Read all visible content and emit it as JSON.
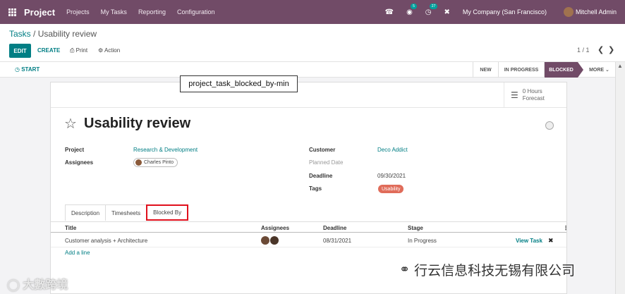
{
  "navbar": {
    "app_name": "Project",
    "menu": [
      "Projects",
      "My Tasks",
      "Reporting",
      "Configuration"
    ],
    "messages_count": "5",
    "activities_count": "27",
    "company": "My Company (San Francisco)",
    "user": "Mitchell Admin",
    "accent_color": "#714b67"
  },
  "control": {
    "breadcrumb_parent": "Tasks",
    "breadcrumb_sep": " / ",
    "breadcrumb_current": "Usability review",
    "edit_label": "EDIT",
    "create_label": "CREATE",
    "print_label": "Print",
    "action_label": "Action",
    "pager": "1 / 1",
    "primary_color": "#017e84"
  },
  "statusbar": {
    "start_label": "START",
    "stages": [
      "NEW",
      "IN PROGRESS",
      "BLOCKED"
    ],
    "active_stage": "BLOCKED",
    "more_label": "MORE"
  },
  "tooltip": "project_task_blocked_by-min",
  "smart_button": {
    "value": "0 Hours",
    "label": "Forecast"
  },
  "task": {
    "title": "Usability review",
    "project_label": "Project",
    "project_value": "Research & Development",
    "assignees_label": "Assignees",
    "assignee": "Charles Pinto",
    "customer_label": "Customer",
    "customer_value": "Deco Addict",
    "planned_date_label": "Planned Date",
    "deadline_label": "Deadline",
    "deadline_value": "09/30/2021",
    "tags_label": "Tags",
    "tag": "Usability"
  },
  "tabs": [
    "Description",
    "Timesheets",
    "Blocked By"
  ],
  "active_tab": "Blocked By",
  "table": {
    "headers": [
      "Title",
      "Assignees",
      "Deadline",
      "Stage"
    ],
    "rows": [
      {
        "title": "Customer analysis + Architecture",
        "deadline": "08/31/2021",
        "stage": "In Progress",
        "action": "View Task"
      }
    ],
    "add_line": "Add a line"
  },
  "watermark": {
    "left": "大數跨境",
    "right": "行云信息科技无锡有限公司"
  }
}
